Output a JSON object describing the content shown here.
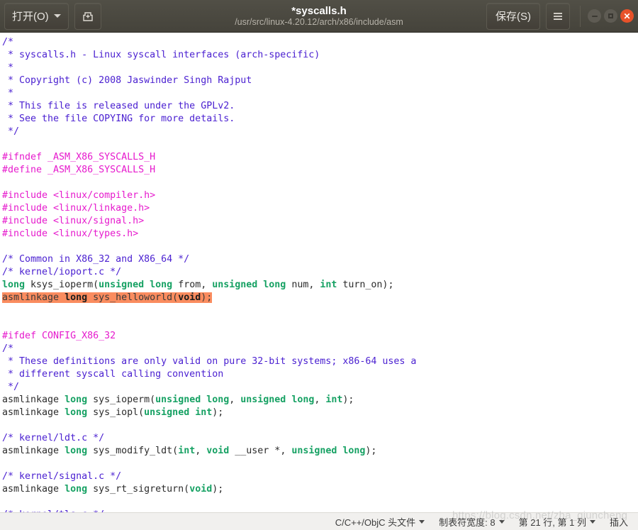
{
  "titlebar": {
    "open_label": "打开(O)",
    "open_icon": "chevron-down-icon",
    "new_doc_icon": "save-as-icon",
    "title": "*syscalls.h",
    "path": "/usr/src/linux-4.20.12/arch/x86/include/asm",
    "save_label": "保存(S)",
    "menu_icon": "hamburger-menu-icon",
    "minimize_icon": "minimize-icon",
    "maximize_icon": "maximize-icon",
    "close_icon": "close-icon",
    "close_color": "#e8522a",
    "bar_color": "#4a483f"
  },
  "editor": {
    "selection_color": "#fa8c5f",
    "comment_color": "#4b21d1",
    "preproc_color": "#e61acd",
    "keyword_color": "#16a163",
    "lines": [
      [
        {
          "t": "/*",
          "c": "cmt"
        }
      ],
      [
        {
          "t": " * syscalls.h - Linux syscall interfaces (arch-specific)",
          "c": "cmt"
        }
      ],
      [
        {
          "t": " *",
          "c": "cmt"
        }
      ],
      [
        {
          "t": " * Copyright (c) 2008 Jaswinder Singh Rajput",
          "c": "cmt"
        }
      ],
      [
        {
          "t": " *",
          "c": "cmt"
        }
      ],
      [
        {
          "t": " * This file is released under the GPLv2.",
          "c": "cmt"
        }
      ],
      [
        {
          "t": " * See the file COPYING for more details.",
          "c": "cmt"
        }
      ],
      [
        {
          "t": " */",
          "c": "cmt"
        }
      ],
      [],
      [
        {
          "t": "#ifndef _ASM_X86_SYSCALLS_H",
          "c": "pp"
        }
      ],
      [
        {
          "t": "#define _ASM_X86_SYSCALLS_H",
          "c": "pp"
        }
      ],
      [],
      [
        {
          "t": "#include <linux/compiler.h>",
          "c": "pp"
        }
      ],
      [
        {
          "t": "#include <linux/linkage.h>",
          "c": "pp"
        }
      ],
      [
        {
          "t": "#include <linux/signal.h>",
          "c": "pp"
        }
      ],
      [
        {
          "t": "#include <linux/types.h>",
          "c": "pp"
        }
      ],
      [],
      [
        {
          "t": "/* Common in X86_32 and X86_64 */",
          "c": "cmt"
        }
      ],
      [
        {
          "t": "/* kernel/ioport.c */",
          "c": "cmt"
        }
      ],
      [
        {
          "t": "long",
          "c": "kw"
        },
        {
          "t": " ksys_ioperm(",
          "c": "pl"
        },
        {
          "t": "unsigned long",
          "c": "kw"
        },
        {
          "t": " from, ",
          "c": "pl"
        },
        {
          "t": "unsigned long",
          "c": "kw"
        },
        {
          "t": " num, ",
          "c": "pl"
        },
        {
          "t": "int",
          "c": "kw"
        },
        {
          "t": " turn_on);",
          "c": "pl"
        }
      ],
      [
        {
          "t": "asmlinkage ",
          "c": "pl",
          "sel": true
        },
        {
          "t": "long",
          "c": "kw",
          "sel": true
        },
        {
          "t": " sys_helloworld(",
          "c": "pl",
          "sel": true
        },
        {
          "t": "void",
          "c": "kw",
          "sel": true
        },
        {
          "t": ");",
          "c": "pl",
          "sel": true
        }
      ],
      [],
      [],
      [
        {
          "t": "#ifdef CONFIG_X86_32",
          "c": "pp"
        }
      ],
      [
        {
          "t": "/*",
          "c": "cmt"
        }
      ],
      [
        {
          "t": " * These definitions are only valid on pure 32-bit systems; x86-64 uses a",
          "c": "cmt"
        }
      ],
      [
        {
          "t": " * different syscall calling convention",
          "c": "cmt"
        }
      ],
      [
        {
          "t": " */",
          "c": "cmt"
        }
      ],
      [
        {
          "t": "asmlinkage ",
          "c": "pl"
        },
        {
          "t": "long",
          "c": "kw"
        },
        {
          "t": " sys_ioperm(",
          "c": "pl"
        },
        {
          "t": "unsigned long",
          "c": "kw"
        },
        {
          "t": ", ",
          "c": "pl"
        },
        {
          "t": "unsigned long",
          "c": "kw"
        },
        {
          "t": ", ",
          "c": "pl"
        },
        {
          "t": "int",
          "c": "kw"
        },
        {
          "t": ");",
          "c": "pl"
        }
      ],
      [
        {
          "t": "asmlinkage ",
          "c": "pl"
        },
        {
          "t": "long",
          "c": "kw"
        },
        {
          "t": " sys_iopl(",
          "c": "pl"
        },
        {
          "t": "unsigned int",
          "c": "kw"
        },
        {
          "t": ");",
          "c": "pl"
        }
      ],
      [],
      [
        {
          "t": "/* kernel/ldt.c */",
          "c": "cmt"
        }
      ],
      [
        {
          "t": "asmlinkage ",
          "c": "pl"
        },
        {
          "t": "long",
          "c": "kw"
        },
        {
          "t": " sys_modify_ldt(",
          "c": "pl"
        },
        {
          "t": "int",
          "c": "kw"
        },
        {
          "t": ", ",
          "c": "pl"
        },
        {
          "t": "void",
          "c": "kw"
        },
        {
          "t": " __user *, ",
          "c": "pl"
        },
        {
          "t": "unsigned long",
          "c": "kw"
        },
        {
          "t": ");",
          "c": "pl"
        }
      ],
      [],
      [
        {
          "t": "/* kernel/signal.c */",
          "c": "cmt"
        }
      ],
      [
        {
          "t": "asmlinkage ",
          "c": "pl"
        },
        {
          "t": "long",
          "c": "kw"
        },
        {
          "t": " sys_rt_sigreturn(",
          "c": "pl"
        },
        {
          "t": "void",
          "c": "kw"
        },
        {
          "t": ");",
          "c": "pl"
        }
      ],
      [],
      [
        {
          "t": "/* kernel/tls.c */",
          "c": "cmt"
        }
      ]
    ]
  },
  "statusbar": {
    "filetype": "C/C++/ObjC 头文件",
    "tabwidth": "制表符宽度: 8",
    "position": "第 21 行, 第 1 列",
    "insert_mode": "插入"
  },
  "watermark": {
    "text": "https://blog.csdn.net/zha_qiuncheng"
  }
}
